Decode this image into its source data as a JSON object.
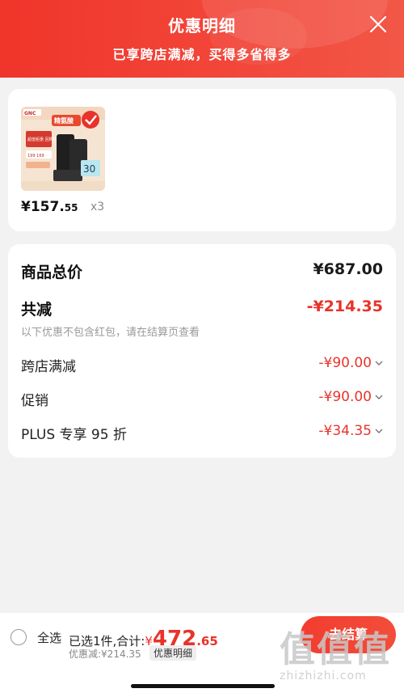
{
  "header": {
    "title": "优惠明细",
    "subtitle": "已享跨店满减，买得多省得多",
    "background": "#f0352b"
  },
  "product": {
    "price_main": "¥157.",
    "price_decimal": "55",
    "quantity": "x3",
    "thumbnail": {
      "brand": "GNC 健安喜",
      "badge_text": "精氨酸",
      "promo_text": "超值钜惠 回购护肝",
      "price_tag": "199 169",
      "count_label": "30"
    }
  },
  "summary": {
    "total_label": "商品总价",
    "total_value": "¥687.00",
    "discount_label": "共减",
    "discount_value": "-¥214.35",
    "note": "以下优惠不包含红包，请在结算页查看",
    "items": [
      {
        "label": "跨店满减",
        "value": "-¥90.00"
      },
      {
        "label": "促销",
        "value": "-¥90.00"
      },
      {
        "label": "PLUS 专享 95 折",
        "value": "-¥34.35"
      }
    ]
  },
  "bottom_bar": {
    "select_all": "全选",
    "selected_text": "已选1件,合计:",
    "currency": "¥",
    "amount": "472",
    "amount_decimal": ".65",
    "discount_text": "优惠减:¥214.35",
    "detail_link": "优惠明细",
    "checkout_label": "去结算"
  },
  "watermark": {
    "logo": "值值值",
    "url": "zhizhizhi.com"
  },
  "colors": {
    "accent_red": "#e8332a",
    "page_bg": "#f2f2f2"
  }
}
